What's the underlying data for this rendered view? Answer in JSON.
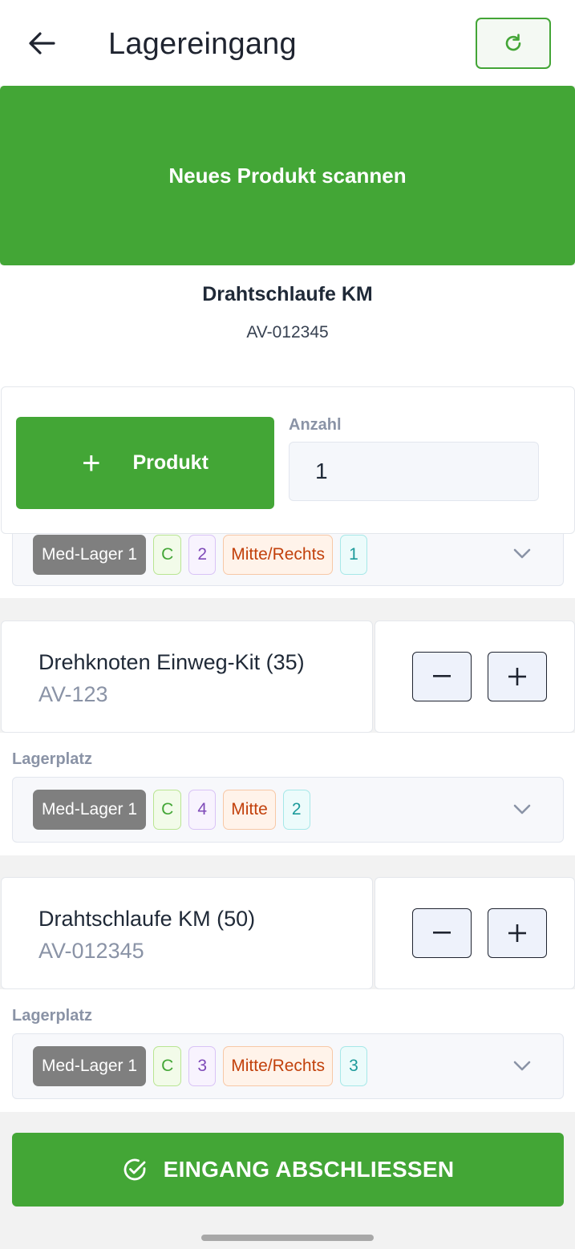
{
  "header": {
    "title": "Lagereingang",
    "back_icon": "arrow-left-icon",
    "refresh_icon": "refresh-icon"
  },
  "scan_button": {
    "label": "Neues Produkt scannen"
  },
  "current_product": {
    "name": "Drahtschlaufe KM",
    "code": "AV-012345"
  },
  "add_form": {
    "add_button_label": "Produkt",
    "quantity_label": "Anzahl",
    "quantity_value": "1"
  },
  "first_location": {
    "store": "Med-Lager 1",
    "chips": [
      "C",
      "2",
      "Mitte/Rechts",
      "1"
    ]
  },
  "items": [
    {
      "name": "Drehknoten Einweg-Kit (35)",
      "code": "AV-123",
      "location_label": "Lagerplatz",
      "location": {
        "store": "Med-Lager 1",
        "chips": [
          "C",
          "4",
          "Mitte",
          "2"
        ]
      }
    },
    {
      "name": "Drahtschlaufe KM (50)",
      "code": "AV-012345",
      "location_label": "Lagerplatz",
      "location": {
        "store": "Med-Lager 1",
        "chips": [
          "C",
          "3",
          "Mitte/Rechts",
          "3"
        ]
      }
    }
  ],
  "stepper": {
    "minus_label": "−",
    "plus_label": "+"
  },
  "footer": {
    "finish_label": "EINGANG ABSCHLIESSEN",
    "finish_icon": "check-circle-icon"
  },
  "colors": {
    "primary_green": "#43a636",
    "text_dark": "#1f2937",
    "muted": "#8a93a6"
  }
}
